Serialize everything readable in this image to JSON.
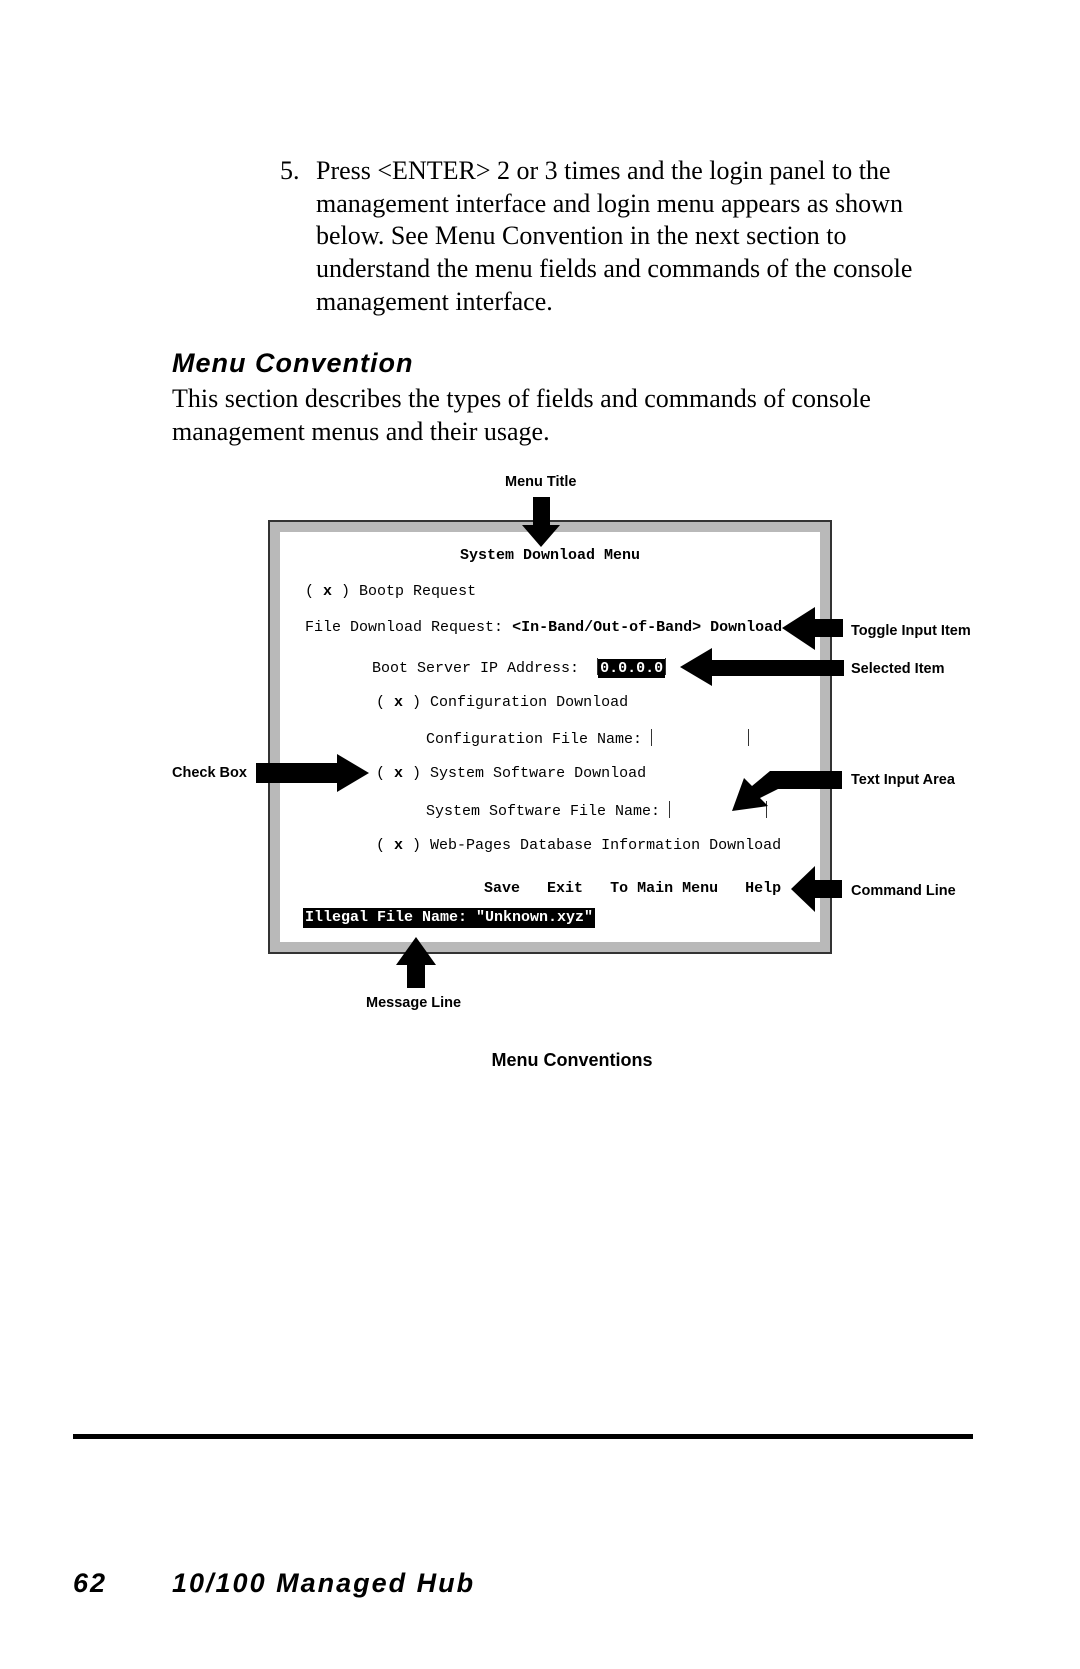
{
  "step": {
    "number": "5.",
    "lines": [
      "Press <ENTER> 2 or 3 times and the login panel to the",
      "management interface and login menu appears as shown",
      "below. See Menu Convention in the next section to",
      "understand the menu fields and commands of the console",
      "management interface."
    ]
  },
  "section": {
    "heading": "Menu Convention",
    "lines": [
      "This section describes the types of fields and commands of console",
      "management menus and their usage."
    ]
  },
  "figure": {
    "callouts": {
      "menu_title": "Menu Title",
      "toggle": "Toggle Input Item",
      "selected": "Selected Item",
      "check_box": "Check Box",
      "text_input": "Text Input Area",
      "command_line": "Command Line",
      "message_line": "Message Line"
    },
    "caption": "Menu Conventions",
    "menu": {
      "title": "System Download Menu",
      "check_mark": "x",
      "bootp": "Bootp Request",
      "file_download_label": "File Download Request:",
      "file_download_value": "<In-Band/Out-of-Band> Download",
      "boot_ip_label": "Boot Server IP Address:",
      "boot_ip_value": "0.0.0.0",
      "config_download": "Configuration Download",
      "config_file_label": "Configuration File Name:",
      "sys_download": "System Software Download",
      "sys_file_label": "System Software File Name:",
      "web_download": "Web-Pages Database Information Download",
      "commands": [
        "Save",
        "Exit",
        "To Main Menu",
        "Help"
      ],
      "message": "Illegal File Name: \"Unknown.xyz\""
    }
  },
  "footer": {
    "page_number": "62",
    "title": "10/100 Managed Hub"
  }
}
